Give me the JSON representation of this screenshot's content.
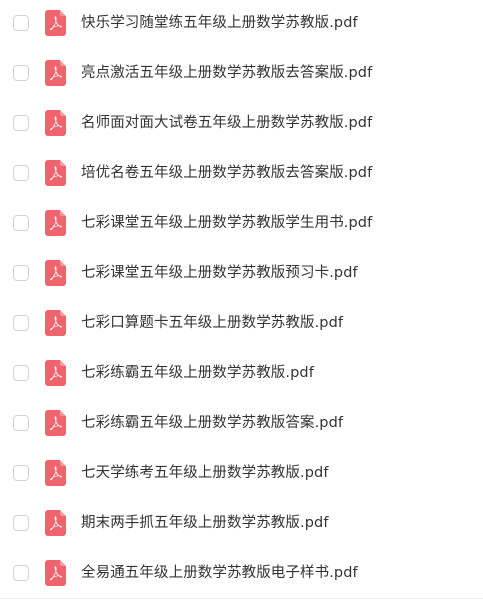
{
  "colors": {
    "pdf_icon": "#f0656d",
    "text": "#333333",
    "checkbox_border": "#d4d4d4"
  },
  "icons": {
    "file": "pdf-file-icon",
    "select": "checkbox"
  },
  "files": [
    {
      "name": "快乐学习随堂练五年级上册数学苏教版.pdf"
    },
    {
      "name": "亮点激活五年级上册数学苏教版去答案版.pdf"
    },
    {
      "name": "名师面对面大试卷五年级上册数学苏教版.pdf"
    },
    {
      "name": "培优名卷五年级上册数学苏教版去答案版.pdf"
    },
    {
      "name": "七彩课堂五年级上册数学苏教版学生用书.pdf"
    },
    {
      "name": "七彩课堂五年级上册数学苏教版预习卡.pdf"
    },
    {
      "name": "七彩口算题卡五年级上册数学苏教版.pdf"
    },
    {
      "name": "七彩练霸五年级上册数学苏教版.pdf"
    },
    {
      "name": "七彩练霸五年级上册数学苏教版答案.pdf"
    },
    {
      "name": "七天学练考五年级上册数学苏教版.pdf"
    },
    {
      "name": "期末两手抓五年级上册数学苏教版.pdf"
    },
    {
      "name": "全易通五年级上册数学苏教版电子样书.pdf"
    }
  ]
}
